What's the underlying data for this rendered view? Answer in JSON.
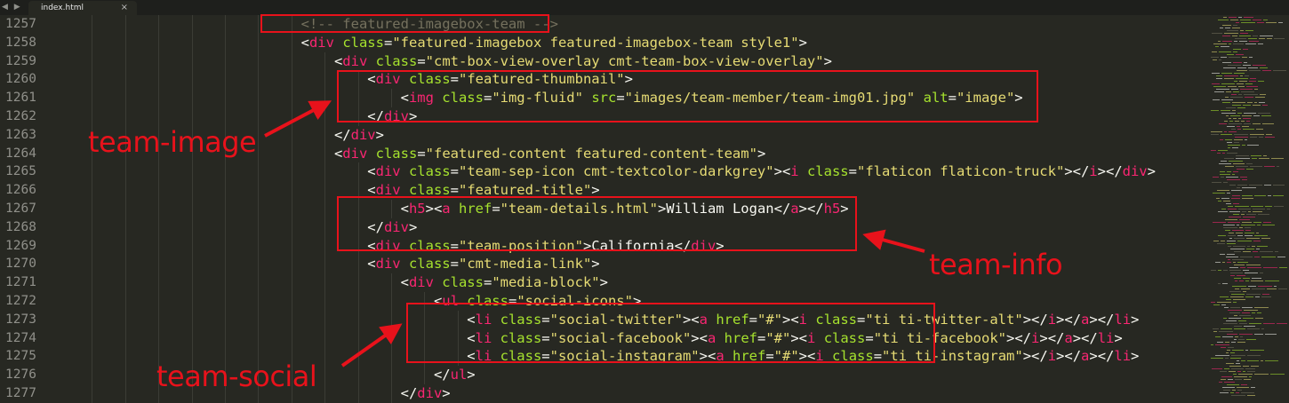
{
  "toolbar": {
    "nav_arrows": "◀ ▶"
  },
  "tab": {
    "title": "index.html",
    "close": "×"
  },
  "line_numbers": [
    "1257",
    "1258",
    "1259",
    "1260",
    "1261",
    "1262",
    "1263",
    "1264",
    "1265",
    "1266",
    "1267",
    "1268",
    "1269",
    "1270",
    "1271",
    "1272",
    "1273",
    "1274",
    "1275",
    "1276",
    "1277"
  ],
  "code_lines": [
    {
      "indent": 29,
      "tokens": [
        [
          "c",
          "<!-- featured-imagebox-team -->"
        ]
      ]
    },
    {
      "indent": 29,
      "tokens": [
        [
          "p",
          "<"
        ],
        [
          "t",
          "div"
        ],
        [
          "p",
          " "
        ],
        [
          "a",
          "class"
        ],
        [
          "p",
          "="
        ],
        [
          "s",
          "\"featured-imagebox featured-imagebox-team style1\""
        ],
        [
          "p",
          ">"
        ]
      ]
    },
    {
      "indent": 33,
      "tokens": [
        [
          "p",
          "<"
        ],
        [
          "t",
          "div"
        ],
        [
          "p",
          " "
        ],
        [
          "a",
          "class"
        ],
        [
          "p",
          "="
        ],
        [
          "s",
          "\"cmt-box-view-overlay cmt-team-box-view-overlay\""
        ],
        [
          "p",
          ">"
        ]
      ]
    },
    {
      "indent": 37,
      "tokens": [
        [
          "p",
          "<"
        ],
        [
          "t",
          "div"
        ],
        [
          "p",
          " "
        ],
        [
          "a",
          "class"
        ],
        [
          "p",
          "="
        ],
        [
          "s",
          "\"featured-thumbnail\""
        ],
        [
          "p",
          ">"
        ]
      ]
    },
    {
      "indent": 41,
      "tokens": [
        [
          "p",
          "<"
        ],
        [
          "t",
          "img"
        ],
        [
          "p",
          " "
        ],
        [
          "a",
          "class"
        ],
        [
          "p",
          "="
        ],
        [
          "s",
          "\"img-fluid\""
        ],
        [
          "p",
          " "
        ],
        [
          "a",
          "src"
        ],
        [
          "p",
          "="
        ],
        [
          "s",
          "\"images/team-member/team-img01.jpg\""
        ],
        [
          "p",
          " "
        ],
        [
          "a",
          "alt"
        ],
        [
          "p",
          "="
        ],
        [
          "s",
          "\"image\""
        ],
        [
          "p",
          ">"
        ]
      ]
    },
    {
      "indent": 37,
      "tokens": [
        [
          "p",
          "</"
        ],
        [
          "t",
          "div"
        ],
        [
          "p",
          ">"
        ]
      ]
    },
    {
      "indent": 33,
      "tokens": [
        [
          "p",
          "</"
        ],
        [
          "t",
          "div"
        ],
        [
          "p",
          ">"
        ]
      ]
    },
    {
      "indent": 33,
      "tokens": [
        [
          "p",
          "<"
        ],
        [
          "t",
          "div"
        ],
        [
          "p",
          " "
        ],
        [
          "a",
          "class"
        ],
        [
          "p",
          "="
        ],
        [
          "s",
          "\"featured-content featured-content-team\""
        ],
        [
          "p",
          ">"
        ]
      ]
    },
    {
      "indent": 37,
      "tokens": [
        [
          "p",
          "<"
        ],
        [
          "t",
          "div"
        ],
        [
          "p",
          " "
        ],
        [
          "a",
          "class"
        ],
        [
          "p",
          "="
        ],
        [
          "s",
          "\"team-sep-icon cmt-textcolor-darkgrey\""
        ],
        [
          "p",
          ">"
        ],
        [
          "p",
          "<"
        ],
        [
          "t",
          "i"
        ],
        [
          "p",
          " "
        ],
        [
          "a",
          "class"
        ],
        [
          "p",
          "="
        ],
        [
          "s",
          "\"flaticon flaticon-truck\""
        ],
        [
          "p",
          "></"
        ],
        [
          "t",
          "i"
        ],
        [
          "p",
          "></"
        ],
        [
          "t",
          "div"
        ],
        [
          "p",
          ">"
        ]
      ]
    },
    {
      "indent": 37,
      "tokens": [
        [
          "p",
          "<"
        ],
        [
          "t",
          "div"
        ],
        [
          "p",
          " "
        ],
        [
          "a",
          "class"
        ],
        [
          "p",
          "="
        ],
        [
          "s",
          "\"featured-title\""
        ],
        [
          "p",
          ">"
        ]
      ]
    },
    {
      "indent": 41,
      "tokens": [
        [
          "p",
          "<"
        ],
        [
          "t",
          "h5"
        ],
        [
          "p",
          "><"
        ],
        [
          "t",
          "a"
        ],
        [
          "p",
          " "
        ],
        [
          "a",
          "href"
        ],
        [
          "p",
          "="
        ],
        [
          "s",
          "\"team-details.html\""
        ],
        [
          "p",
          ">William Logan</"
        ],
        [
          "t",
          "a"
        ],
        [
          "p",
          "></"
        ],
        [
          "t",
          "h5"
        ],
        [
          "p",
          ">"
        ]
      ]
    },
    {
      "indent": 37,
      "tokens": [
        [
          "p",
          "</"
        ],
        [
          "t",
          "div"
        ],
        [
          "p",
          ">"
        ]
      ]
    },
    {
      "indent": 37,
      "tokens": [
        [
          "p",
          "<"
        ],
        [
          "t",
          "div"
        ],
        [
          "p",
          " "
        ],
        [
          "a",
          "class"
        ],
        [
          "p",
          "="
        ],
        [
          "s",
          "\"team-position\""
        ],
        [
          "p",
          ">California</"
        ],
        [
          "t",
          "div"
        ],
        [
          "p",
          ">"
        ]
      ]
    },
    {
      "indent": 37,
      "tokens": [
        [
          "p",
          "<"
        ],
        [
          "t",
          "div"
        ],
        [
          "p",
          " "
        ],
        [
          "a",
          "class"
        ],
        [
          "p",
          "="
        ],
        [
          "s",
          "\"cmt-media-link\""
        ],
        [
          "p",
          ">"
        ]
      ]
    },
    {
      "indent": 41,
      "tokens": [
        [
          "p",
          "<"
        ],
        [
          "t",
          "div"
        ],
        [
          "p",
          " "
        ],
        [
          "a",
          "class"
        ],
        [
          "p",
          "="
        ],
        [
          "s",
          "\"media-block\""
        ],
        [
          "p",
          ">"
        ]
      ]
    },
    {
      "indent": 45,
      "tokens": [
        [
          "p",
          "<"
        ],
        [
          "t",
          "ul"
        ],
        [
          "p",
          " "
        ],
        [
          "a",
          "class"
        ],
        [
          "p",
          "="
        ],
        [
          "s",
          "\"social-icons\""
        ],
        [
          "p",
          ">"
        ]
      ]
    },
    {
      "indent": 49,
      "tokens": [
        [
          "p",
          "<"
        ],
        [
          "t",
          "li"
        ],
        [
          "p",
          " "
        ],
        [
          "a",
          "class"
        ],
        [
          "p",
          "="
        ],
        [
          "s",
          "\"social-twitter\""
        ],
        [
          "p",
          ">"
        ],
        [
          "p",
          "<"
        ],
        [
          "t",
          "a"
        ],
        [
          "p",
          " "
        ],
        [
          "a",
          "href"
        ],
        [
          "p",
          "="
        ],
        [
          "s",
          "\"#\""
        ],
        [
          "p",
          "><"
        ],
        [
          "t",
          "i"
        ],
        [
          "p",
          " "
        ],
        [
          "a",
          "class"
        ],
        [
          "p",
          "="
        ],
        [
          "s",
          "\"ti ti-twitter-alt\""
        ],
        [
          "p",
          "></"
        ],
        [
          "t",
          "i"
        ],
        [
          "p",
          "></"
        ],
        [
          "t",
          "a"
        ],
        [
          "p",
          "></"
        ],
        [
          "t",
          "li"
        ],
        [
          "p",
          ">"
        ]
      ]
    },
    {
      "indent": 49,
      "tokens": [
        [
          "p",
          "<"
        ],
        [
          "t",
          "li"
        ],
        [
          "p",
          " "
        ],
        [
          "a",
          "class"
        ],
        [
          "p",
          "="
        ],
        [
          "s",
          "\"social-facebook\""
        ],
        [
          "p",
          ">"
        ],
        [
          "p",
          "<"
        ],
        [
          "t",
          "a"
        ],
        [
          "p",
          " "
        ],
        [
          "a",
          "href"
        ],
        [
          "p",
          "="
        ],
        [
          "s",
          "\"#\""
        ],
        [
          "p",
          "><"
        ],
        [
          "t",
          "i"
        ],
        [
          "p",
          " "
        ],
        [
          "a",
          "class"
        ],
        [
          "p",
          "="
        ],
        [
          "s",
          "\"ti ti-facebook\""
        ],
        [
          "p",
          "></"
        ],
        [
          "t",
          "i"
        ],
        [
          "p",
          "></"
        ],
        [
          "t",
          "a"
        ],
        [
          "p",
          "></"
        ],
        [
          "t",
          "li"
        ],
        [
          "p",
          ">"
        ]
      ]
    },
    {
      "indent": 49,
      "tokens": [
        [
          "p",
          "<"
        ],
        [
          "t",
          "li"
        ],
        [
          "p",
          " "
        ],
        [
          "a",
          "class"
        ],
        [
          "p",
          "="
        ],
        [
          "s",
          "\"social-instagram\""
        ],
        [
          "p",
          ">"
        ],
        [
          "p",
          "<"
        ],
        [
          "t",
          "a"
        ],
        [
          "p",
          " "
        ],
        [
          "a",
          "href"
        ],
        [
          "p",
          "="
        ],
        [
          "s",
          "\"#\""
        ],
        [
          "p",
          "><"
        ],
        [
          "t",
          "i"
        ],
        [
          "p",
          " "
        ],
        [
          "a",
          "class"
        ],
        [
          "p",
          "="
        ],
        [
          "s",
          "\"ti ti-instagram\""
        ],
        [
          "p",
          "></"
        ],
        [
          "t",
          "i"
        ],
        [
          "p",
          "></"
        ],
        [
          "t",
          "a"
        ],
        [
          "p",
          "></"
        ],
        [
          "t",
          "li"
        ],
        [
          "p",
          ">"
        ]
      ]
    },
    {
      "indent": 45,
      "tokens": [
        [
          "p",
          "</"
        ],
        [
          "t",
          "ul"
        ],
        [
          "p",
          ">"
        ]
      ]
    },
    {
      "indent": 41,
      "tokens": [
        [
          "p",
          "</"
        ],
        [
          "t",
          "div"
        ],
        [
          "p",
          ">"
        ]
      ]
    }
  ],
  "annotations": {
    "team_image": "team-image",
    "team_info": "team-info",
    "team_social": "team-social",
    "color": "#e8121b"
  },
  "syntax_colors": {
    "background": "#272822",
    "tag": "#f92672",
    "attribute": "#a6e22e",
    "string": "#e6db74",
    "comment": "#75715e",
    "text": "#f8f8f2"
  }
}
